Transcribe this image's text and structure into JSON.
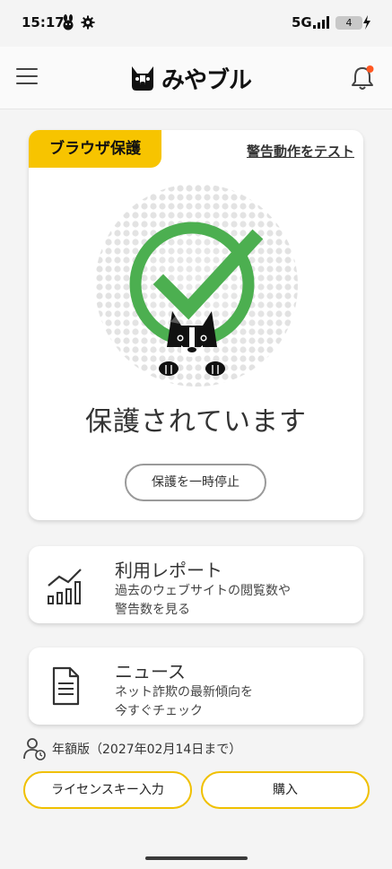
{
  "status_bar": {
    "time": "15:17",
    "network": "5G",
    "battery": "4"
  },
  "app_bar": {
    "logo_text": "みやブル"
  },
  "protection_card": {
    "tag": "ブラウザ保護",
    "test_link": "警告動作をテスト",
    "status": "保護されています",
    "pause_button": "保護を一時停止",
    "status_color": "#4caf50"
  },
  "report_card": {
    "title": "利用レポート",
    "desc_line1": "過去のウェブサイトの閲覧数や",
    "desc_line2": "警告数を見る"
  },
  "news_card": {
    "title": "ニュース",
    "desc_line1": "ネット詐欺の最新傾向を",
    "desc_line2": "今すぐチェック"
  },
  "license": {
    "text": "年額版（2027年02月14日まで）"
  },
  "buttons": {
    "license_key": "ライセンスキー入力",
    "buy": "購入"
  },
  "colors": {
    "accent": "#f7c400",
    "notification_dot": "#ff5722"
  }
}
